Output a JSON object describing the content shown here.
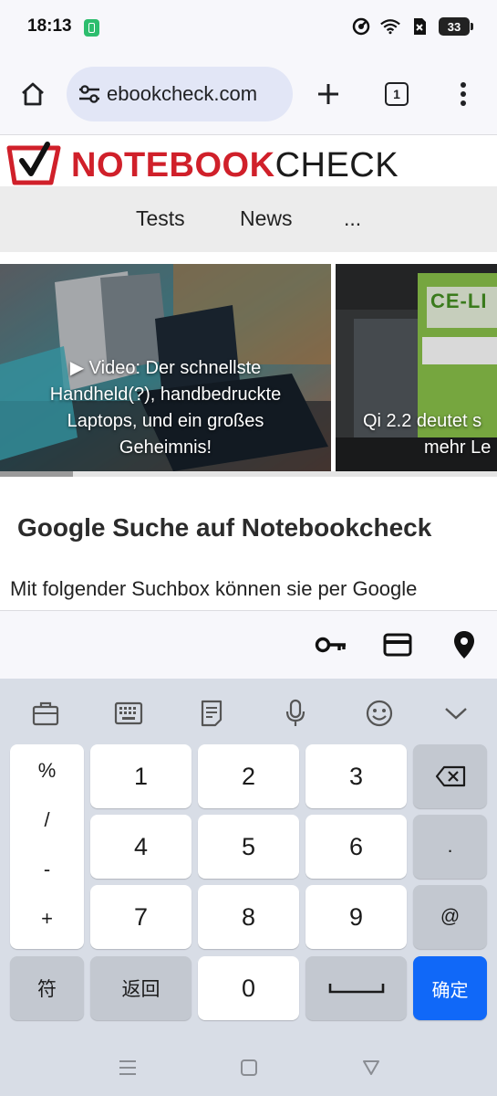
{
  "status": {
    "time": "18:13",
    "battery": "33"
  },
  "browser": {
    "url": "ebookcheck.com",
    "tab_count": "1"
  },
  "site": {
    "logo_red": "NOTEBOOK",
    "logo_black": "CHECK",
    "nav": [
      "Tests",
      "News",
      "..."
    ]
  },
  "carousel": {
    "slides": [
      {
        "caption_line1": "▶ Video: Der schnellste",
        "caption_line2": "Handheld(?), handbedruckte",
        "caption_line3": "Laptops, und ein großes",
        "caption_line4": "Geheimnis!"
      },
      {
        "caption_line1": "Qi 2.2 deutet s",
        "caption_line2": "mehr Le"
      }
    ],
    "booth_sign": "CE-LI"
  },
  "article": {
    "title": "Google Suche auf Notebookcheck",
    "body": "Mit folgender Suchbox können sie per Google"
  },
  "keyboard": {
    "symbols": [
      "%",
      "/",
      "-",
      "+"
    ],
    "digits": [
      "1",
      "2",
      "3",
      "4",
      "5",
      "6",
      "7",
      "8",
      "9",
      "0"
    ],
    "dot": ".",
    "at": "@",
    "symbol_switch": "符",
    "back": "返回",
    "confirm": "确定"
  },
  "colors": {
    "brand_red": "#d0202a",
    "confirm_blue": "#1068f8",
    "url_pill": "#e2e6f6"
  }
}
